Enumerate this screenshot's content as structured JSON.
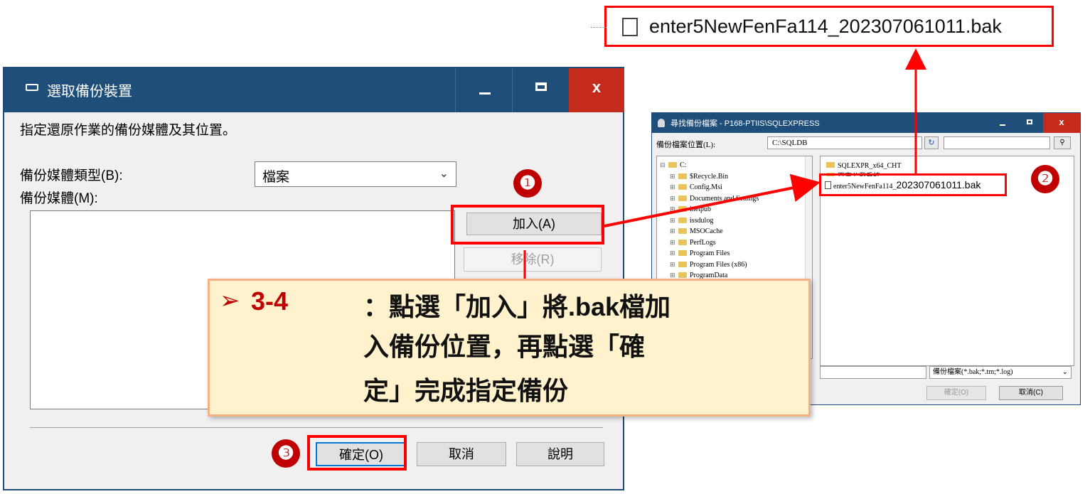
{
  "dialog_main": {
    "title": "選取備份裝置",
    "description": "指定還原作業的備份媒體及其位置。",
    "media_type_label": "備份媒體類型(B):",
    "media_type_value": "檔案",
    "media_label": "備份媒體(M):",
    "add_button": "加入(A)",
    "remove_button": "移除(R)",
    "ok_button": "確定(O)",
    "cancel_button": "取消",
    "help_button": "說明",
    "window_buttons": {
      "minimize": "—",
      "maximize": "□",
      "close": "x"
    }
  },
  "dialog_locate": {
    "title": "尋找備份檔案 - P168-PTIIS\\SQLEXPRESS",
    "location_label": "備份檔案位置(L):",
    "location_value": "C:\\SQLDB",
    "tree": [
      {
        "label": "C:",
        "root": true
      },
      {
        "label": "$Recycle.Bin"
      },
      {
        "label": "Config.Msi"
      },
      {
        "label": "Documents and Settings"
      },
      {
        "label": "inetpub"
      },
      {
        "label": "issdulog"
      },
      {
        "label": "MSOCache"
      },
      {
        "label": "PerfLogs"
      },
      {
        "label": "Program Files"
      },
      {
        "label": "Program Files (x86)"
      },
      {
        "label": "ProgramData"
      }
    ],
    "files": [
      {
        "label": "SQLEXPR_x64_CHT",
        "type": "folder"
      },
      {
        "label": "百事公發系統",
        "type": "folder"
      }
    ],
    "selected_file_prefix": "enter5NewFenFa114_",
    "selected_file_suffix": "202307061011.bak",
    "filter_value": "備份檔案(*.bak;*.tm;*.log)",
    "ok_button": "確定(O)",
    "cancel_button": "取消(C)"
  },
  "callout_file": "enter5NewFenFa114_202307061011.bak",
  "step_numbers": [
    "❶",
    "❷",
    "❸"
  ],
  "note": {
    "bullet": "➢",
    "step": "3-4",
    "line1": "：點選「加入」將.bak檔加",
    "line2": "入備份位置，再點選「確",
    "line3": "定」完成指定備份"
  },
  "colors": {
    "titlebar": "#1e4e79",
    "close": "#c42b1c",
    "highlight": "#ff0000",
    "step_badge": "#c00000",
    "note_bg": "#fff2cc",
    "note_border": "#f4b183"
  }
}
